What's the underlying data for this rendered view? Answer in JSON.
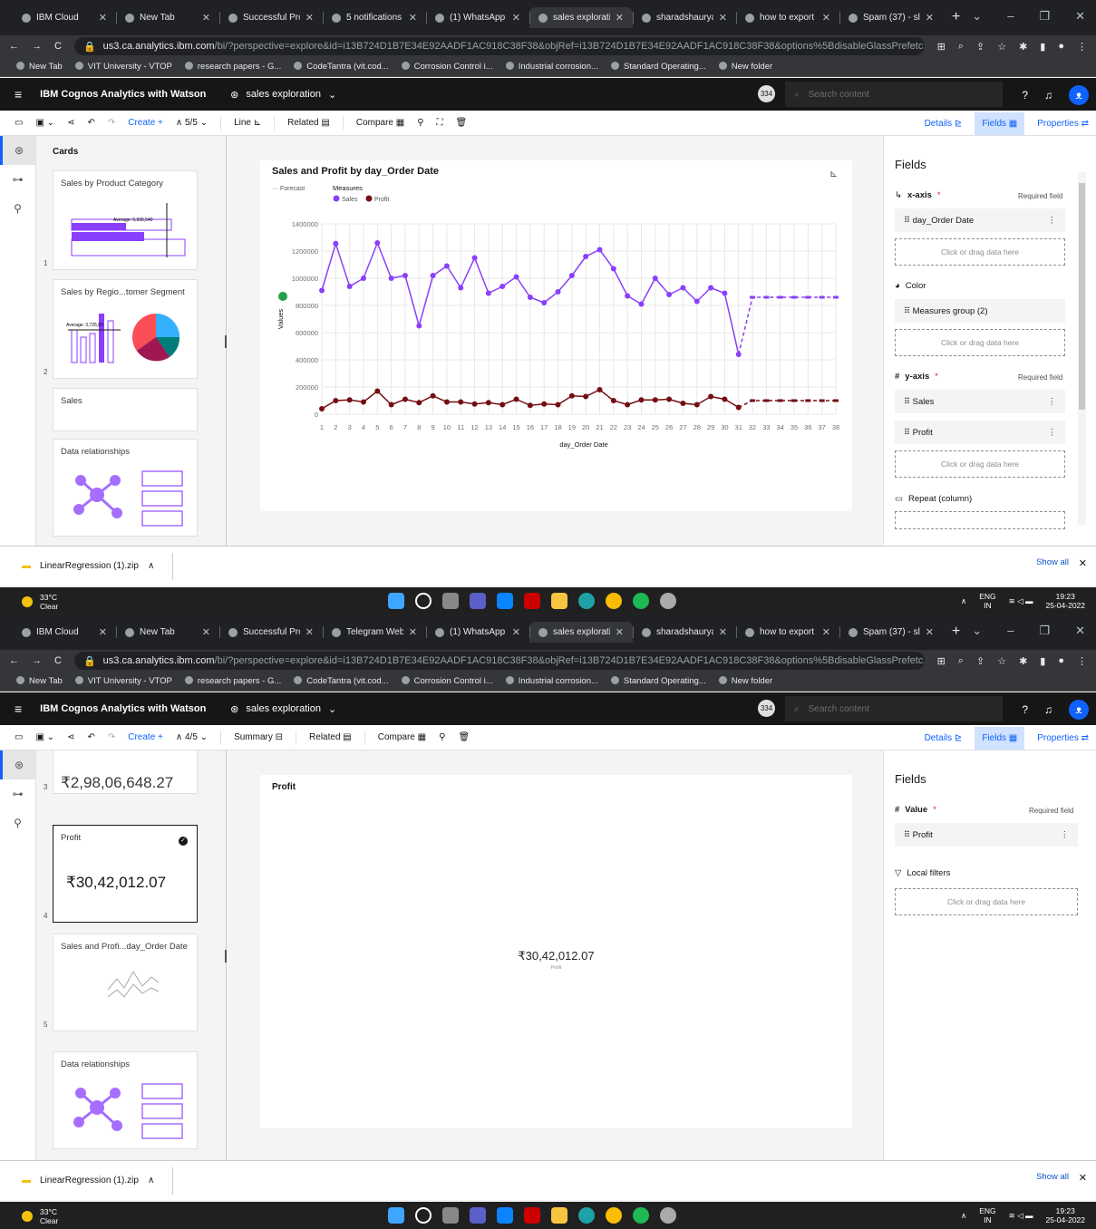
{
  "browser": {
    "tabs1": [
      "IBM Cloud",
      "New Tab",
      "Successful Pro",
      "5 notifications",
      "(1) WhatsApp",
      "sales explorati",
      "sharadshaurya",
      "how to export",
      "Spam (37) - sl"
    ],
    "tabs2": [
      "IBM Cloud",
      "New Tab",
      "Successful Pro",
      "Telegram Web",
      "(1) WhatsApp",
      "sales explorati",
      "sharadshaurya",
      "how to export",
      "Spam (37) - sl"
    ],
    "url_domain": "us3.ca.analytics.ibm.com",
    "url_path": "/bi/?perspective=explore&id=i13B724D1B7E34E92AADF1AC918C38F38&objRef=i13B724D1B7E34E92AADF1AC918C38F38&options%5BdisableGlassPrefetc...",
    "bookmarks": [
      "New Tab",
      "VIT University - VTOP",
      "research papers - G...",
      "CodeTantra (vit.cod...",
      "Corrosion Control i...",
      "Industrial corrosion...",
      "Standard Operating...",
      "New folder"
    ]
  },
  "app": {
    "product": "IBM Cognos Analytics with Watson",
    "dashboard": "sales exploration",
    "badge": "334",
    "search_placeholder": "Search content",
    "toolbar": {
      "create": "Create",
      "page1": "5/5",
      "page2": "4/5",
      "viz1": "Line",
      "viz2": "Summary",
      "related": "Related",
      "compare": "Compare"
    },
    "rtabs": [
      "Details",
      "Fields",
      "Properties"
    ],
    "cards_header": "Cards"
  },
  "screen1": {
    "cards": [
      {
        "title": "Sales by Product Category",
        "num": "1",
        "avg": "Average: 9,935,549"
      },
      {
        "title": "Sales by Regio...tomer Segment",
        "num": "2",
        "avg": "Average: 3,725,83"
      },
      {
        "title": "Sales"
      },
      {
        "title": "Data relationships"
      }
    ],
    "panel": {
      "title": "Fields",
      "xaxis": "x-axis",
      "required": "Required field",
      "x_field": "day_Order Date",
      "drop": "Click or drag data here",
      "color": "Color",
      "color_field": "Measures group (2)",
      "yaxis": "y-axis",
      "y_field1": "Sales",
      "y_field2": "Profit",
      "repeat": "Repeat (column)"
    }
  },
  "screen2": {
    "cards": [
      {
        "title_cut": "₹2,98,06,648.27",
        "num": "3"
      },
      {
        "title": "Profit",
        "value": "₹30,42,012.07",
        "num": "4"
      },
      {
        "title": "Sales and Profi...day_Order Date",
        "num": "5"
      },
      {
        "title": "Data relationships"
      }
    ],
    "viz_title": "Profit",
    "viz_value": "₹30,42,012.07",
    "panel": {
      "title": "Fields",
      "value_lbl": "Value",
      "required": "Required field",
      "field": "Profit",
      "filters": "Local filters",
      "drop": "Click or drag data here"
    }
  },
  "download": {
    "file": "LinearRegression (1).zip",
    "showall": "Show all"
  },
  "taskbar": {
    "temp": "33°C",
    "cond": "Clear",
    "lang": "ENG",
    "region": "IN",
    "time": "19:23",
    "date": "25-04-2022"
  },
  "chart_data": {
    "type": "line",
    "title": "Sales and Profit by day_Order Date",
    "xlabel": "day_Order Date",
    "ylabel": "Values",
    "legend_forecast": "Forecast",
    "legend_measures": "Measures",
    "ylim": [
      0,
      1400000
    ],
    "yticks": [
      0,
      200000,
      400000,
      600000,
      800000,
      1000000,
      1200000,
      1400000
    ],
    "x": [
      1,
      2,
      3,
      4,
      5,
      6,
      7,
      8,
      9,
      10,
      11,
      12,
      13,
      14,
      15,
      16,
      17,
      18,
      19,
      20,
      21,
      22,
      23,
      24,
      25,
      26,
      27,
      28,
      29,
      30,
      31,
      32,
      33,
      34,
      35,
      36,
      37,
      38
    ],
    "forecast_start": 32,
    "series": [
      {
        "name": "Sales",
        "color": "#8a3ffc",
        "values": [
          910000,
          1255000,
          940000,
          1000000,
          1260000,
          1000000,
          1020000,
          650000,
          1020000,
          1090000,
          930000,
          1150000,
          890000,
          940000,
          1010000,
          860000,
          820000,
          900000,
          1020000,
          1160000,
          1210000,
          1070000,
          870000,
          810000,
          1000000,
          880000,
          930000,
          830000,
          930000,
          890000,
          440000,
          860000,
          860000,
          860000,
          860000,
          860000,
          860000,
          860000
        ]
      },
      {
        "name": "Profit",
        "color": "#750e13",
        "values": [
          40000,
          100000,
          105000,
          90000,
          170000,
          70000,
          110000,
          85000,
          135000,
          90000,
          90000,
          75000,
          85000,
          70000,
          110000,
          65000,
          75000,
          70000,
          135000,
          130000,
          180000,
          100000,
          70000,
          105000,
          105000,
          110000,
          80000,
          70000,
          130000,
          110000,
          50000,
          100000,
          100000,
          100000,
          100000,
          100000,
          100000,
          100000
        ]
      }
    ]
  }
}
